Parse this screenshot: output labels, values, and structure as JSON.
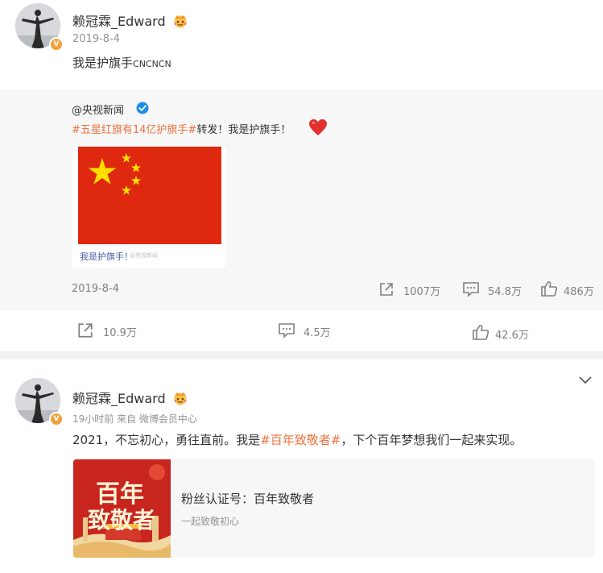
{
  "post1": {
    "author": "赖冠霖_Edward",
    "date": "2019-8-4",
    "text": "我是护旗手",
    "text_suffix": "CNCNCN",
    "repost": {
      "author": "@央视新闻",
      "topic": "#五星红旗有14亿护旗手#",
      "text": "转发！我是护旗手！",
      "image_caption": "我是护旗手！",
      "image_watermark": "@央视新闻",
      "date": "2019-8-4",
      "reposts": "1007万",
      "comments": "54.8万",
      "likes": "486万"
    },
    "actions": {
      "reposts": "10.9万",
      "comments": "4.5万",
      "likes": "42.6万"
    }
  },
  "post2": {
    "author": "赖冠霖_Edward",
    "time": "19小时前",
    "source": "来自 微博会员中心",
    "text_before": "2021，不忘初心，勇往直前。我是",
    "topic": "#百年致敬者#",
    "text_after": "，下个百年梦想我们一起来实现。",
    "card": {
      "title": "粉丝认证号：百年致敬者",
      "subtitle": "一起致敬初心",
      "image_text_1": "百年",
      "image_text_2": "致敬者"
    }
  },
  "colors": {
    "topic": "#eb7340",
    "verified_blue": "#1e8ee8",
    "badge_orange": "#f2a13a",
    "flag_red": "#de2910",
    "flag_yellow": "#ffde00",
    "heart_red": "#e0312f"
  },
  "icons": {
    "member": "member-crown-icon",
    "verified": "verified-check-icon",
    "repost": "repost-icon",
    "comment": "comment-icon",
    "like": "thumbs-up-icon",
    "heart": "heart-icon",
    "more": "chevron-down-icon"
  }
}
